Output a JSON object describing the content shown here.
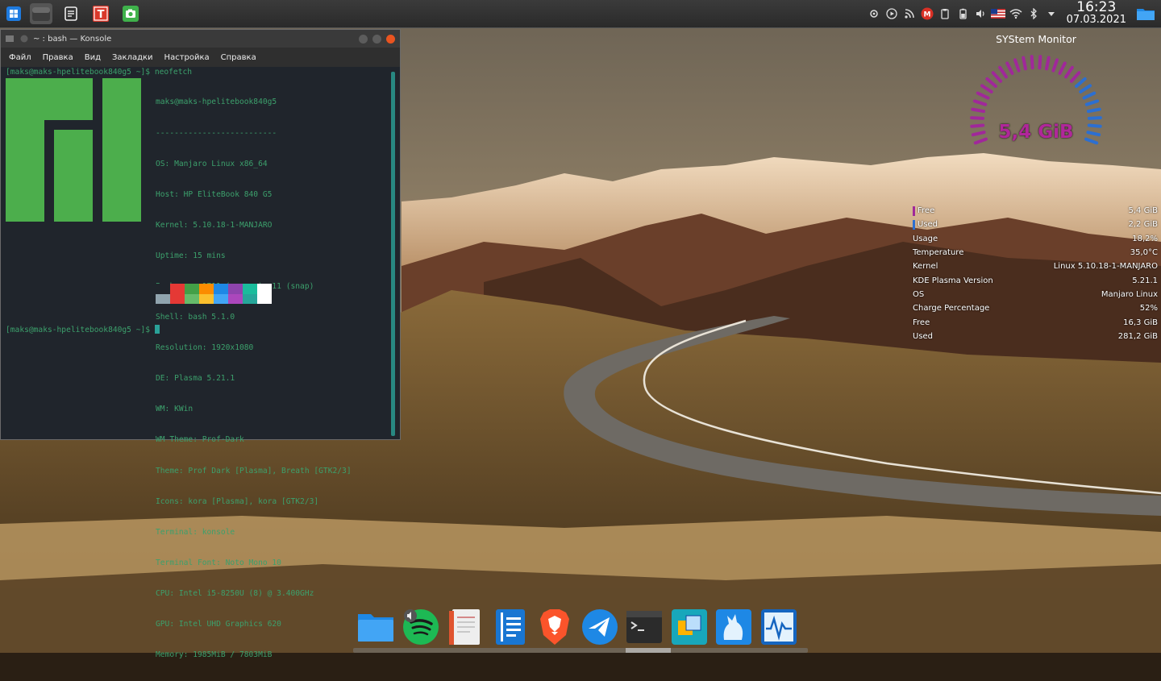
{
  "taskbar": {
    "launcher_icon": "windows-start-icon",
    "items": [
      {
        "icon": "window-overview-icon",
        "active": true
      },
      {
        "icon": "notes-icon",
        "active": false
      },
      {
        "icon": "typora-icon",
        "letter": "T",
        "active": false
      },
      {
        "icon": "screenshot-icon",
        "active": false
      }
    ]
  },
  "tray": {
    "icons": [
      "kde-connect-icon",
      "media-player-icon",
      "rss-icon",
      "gmail-icon",
      "clipboard-icon",
      "battery-icon",
      "volume-icon",
      "us-flag-icon",
      "wifi-icon",
      "bluetooth-icon",
      "expand-arrow-icon"
    ],
    "gmail_letter": "M",
    "time": "16:23",
    "date": "07.03.2021",
    "show_desktop_icon": "folder-icon"
  },
  "konsole": {
    "title": "~ : bash — Konsole",
    "menu": [
      "Файл",
      "Правка",
      "Вид",
      "Закладки",
      "Настройка",
      "Справка"
    ],
    "prompt_command": "[maks@maks-hpelitebook840g5 ~]$ neofetch",
    "info": [
      "maks@maks-hpelitebook840g5",
      "--------------------------",
      "OS: Manjaro Linux x86_64",
      "Host: HP EliteBook 840 G5",
      "Kernel: 5.10.18-1-MANJARO",
      "Uptime: 15 mins",
      "Packages: 1711 (pacman), 11 (snap)",
      "Shell: bash 5.1.0",
      "Resolution: 1920x1080",
      "DE: Plasma 5.21.1",
      "WM: KWin",
      "WM Theme: Prof-Dark",
      "Theme: Prof Dark [Plasma], Breath [GTK2/3]",
      "Icons: kora [Plasma], kora [GTK2/3]",
      "Terminal: konsole",
      "Terminal Font: Noto Mono 10",
      "CPU: Intel i5-8250U (8) @ 3.400GHz",
      "GPU: Intel UHD Graphics 620",
      "Memory: 1985MiB / 7803MiB"
    ],
    "colors_top": [
      "#20252c",
      "#e53935",
      "#43a047",
      "#fb8c00",
      "#1e88e5",
      "#8e44ad",
      "#1abc9c",
      "#ffffff"
    ],
    "colors_bottom": [
      "#90a4ae",
      "#e53935",
      "#66bb6a",
      "#fbc02d",
      "#42a5f5",
      "#ab47bc",
      "#26a69a",
      "#ffffff"
    ],
    "prompt_final": "[maks@maks-hpelitebook840g5 ~]$ ",
    "text_color": "#3ca06c"
  },
  "system_monitor": {
    "title": "SYStem Monitor",
    "gauge_value": "5,4 GiB",
    "gauge_fraction": 0.7,
    "stats": [
      {
        "label": "Free",
        "value": "5,4 GiB",
        "mark": "#a0289a"
      },
      {
        "label": "Used",
        "value": "2,2 GiB",
        "mark": "#2c6fd1"
      },
      {
        "label": "Usage",
        "value": "18,2%"
      },
      {
        "label": "Temperature",
        "value": "35,0°C"
      },
      {
        "label": "Kernel",
        "value": "Linux 5.10.18-1-MANJARO"
      },
      {
        "label": "KDE Plasma Version",
        "value": "5.21.1"
      },
      {
        "label": "OS",
        "value": "Manjaro Linux"
      },
      {
        "label": "Charge Percentage",
        "value": "52%"
      },
      {
        "label": "Free",
        "value": "16,3 GiB"
      },
      {
        "label": "Used",
        "value": "281,2 GiB"
      }
    ]
  },
  "dock": {
    "apps": [
      "file-manager-icon",
      "spotify-icon",
      "document-viewer-icon",
      "text-editor-icon",
      "brave-browser-icon",
      "kotatogram-icon",
      "terminal-icon",
      "virtualbox-icon",
      "gimp-icon",
      "system-monitor-icon"
    ]
  }
}
